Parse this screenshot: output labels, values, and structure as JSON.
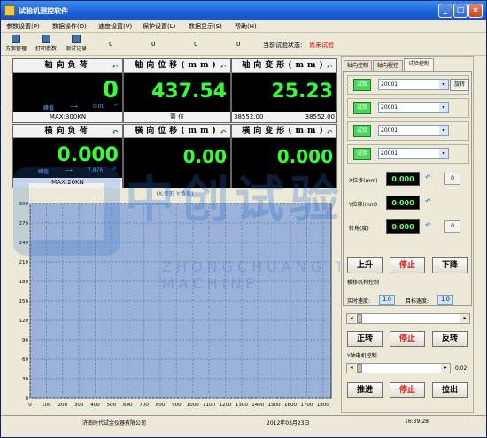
{
  "window": {
    "title": "试验机测控软件"
  },
  "menu": [
    "参数设置(P)",
    "数据操作(D)",
    "速度设置(V)",
    "保护设置(L)",
    "数据显示(S)",
    "帮助(H)"
  ],
  "toolbar": {
    "buttons": [
      "方案管理",
      "打印参数",
      "测试记录"
    ],
    "nums": [
      "0",
      "0",
      "0",
      "0",
      "0"
    ],
    "status_label": "当前试验状态:",
    "status_value": "尚未试验"
  },
  "panels": {
    "axial_load": {
      "title": "轴向负荷",
      "value": "0",
      "peak_label": "峰值",
      "peak_arrow": "⟶",
      "peak_value": "0.00",
      "footer": "MAX:300KN"
    },
    "axial_pos": {
      "title": "轴向位移(mm)",
      "value": "437.54",
      "footer": "置 位"
    },
    "axial_def": {
      "title": "轴向变形(mm)",
      "value": "25.23",
      "footer_left": "38552.00",
      "footer_right": "38552.00"
    },
    "trans_load": {
      "title": "横向负荷",
      "value": "0.000",
      "peak_label": "峰值",
      "peak_arrow": "⟶",
      "peak_value": "7.876",
      "footer": "MAX:20KN"
    },
    "trans_pos": {
      "title": "横向位移(mm)",
      "value": "0.00"
    },
    "trans_def": {
      "title": "横向变形(mm)",
      "value": "0.000"
    }
  },
  "chart_caption": "(X:变形  Y:负荷)",
  "chart_data": {
    "type": "line",
    "xlabel": "",
    "ylabel": "",
    "x_ticks": [
      0,
      100,
      200,
      300,
      400,
      500,
      600,
      700,
      800,
      900,
      1000,
      1100,
      1200,
      1300,
      1400,
      1500,
      1600,
      1700,
      1800
    ],
    "y_ticks": [
      0,
      30,
      60,
      90,
      120,
      150,
      180,
      210,
      240,
      270,
      300
    ],
    "xlim": [
      0,
      1850
    ],
    "ylim": [
      0,
      300
    ],
    "series": [],
    "grid": true
  },
  "right": {
    "tabs": [
      "轴向控制",
      "轴向程控",
      "试验控制"
    ],
    "groups": [
      {
        "btn": "试验",
        "value": "20001",
        "extra": "旋转"
      },
      {
        "btn": "试验",
        "value": "20001"
      },
      {
        "btn": "试验",
        "value": "20001"
      },
      {
        "btn": "试验",
        "value": "20001"
      }
    ],
    "shifts": [
      {
        "label": "X位移(mm)",
        "value": "0.000",
        "num": "0"
      },
      {
        "label": "Y位移(mm)",
        "value": "0.000"
      },
      {
        "label": "转角(度)",
        "value": "0.000",
        "num": "0"
      }
    ],
    "axial_buttons": {
      "up": "上升",
      "stop": "停止",
      "down": "下降"
    },
    "horizontal_label": "横移机构控制",
    "speed_label": "实时速度:",
    "speed_value": "1.0",
    "target_label": "目标速度:",
    "target_value": "1.0",
    "rotate_buttons": {
      "fwd": "正转",
      "stop": "停止",
      "rev": "反转"
    },
    "y_label": "Y轴电机控制",
    "y_value": "0.02",
    "push_buttons": {
      "push": "推进",
      "stop": "停止",
      "pull": "拉出"
    }
  },
  "statusbar": {
    "company": "济南时代试金仪器有限公司",
    "date": "2012年03月23日",
    "time": "16:39:28"
  },
  "watermark": {
    "text": "中创试验机",
    "sub": "ZHONGCHUANG TESTING MACHINE"
  }
}
